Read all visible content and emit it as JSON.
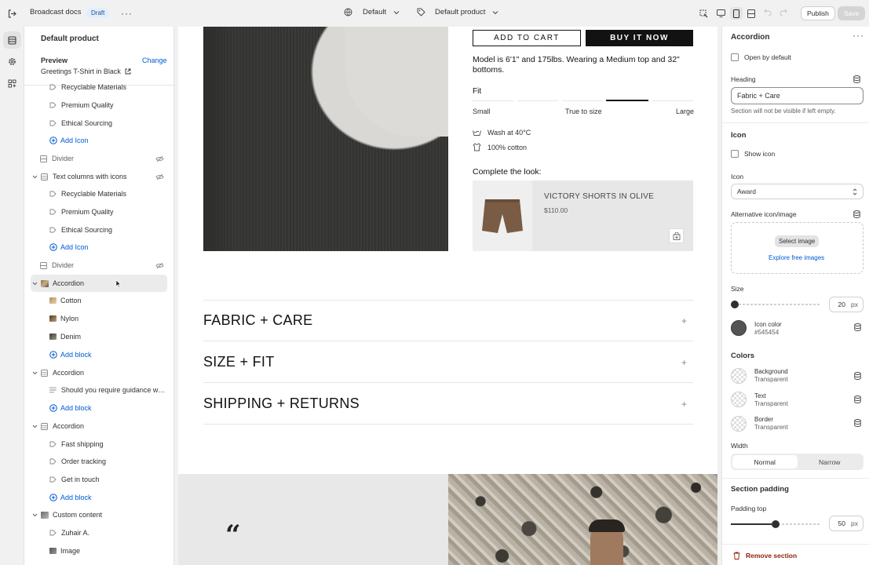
{
  "topbar": {
    "doc_title": "Broadcast docs",
    "status_badge": "Draft",
    "theme_label": "Default",
    "template_label": "Default product",
    "publish_label": "Publish",
    "save_label": "Save"
  },
  "left_panel": {
    "title": "Default product",
    "preview_label": "Preview",
    "change_label": "Change",
    "preview_product": "Greetings T-Shirt in Black",
    "items": [
      {
        "label": "Recyclable Materials"
      },
      {
        "label": "Premium Quality"
      },
      {
        "label": "Ethical Sourcing"
      },
      {
        "label": "Add Icon"
      },
      {
        "label": "Divider"
      },
      {
        "label": "Text columns with icons"
      },
      {
        "label": "Recyclable Materials"
      },
      {
        "label": "Premium Quality"
      },
      {
        "label": "Ethical Sourcing"
      },
      {
        "label": "Add Icon"
      },
      {
        "label": "Divider"
      },
      {
        "label": "Accordion"
      },
      {
        "label": "Cotton"
      },
      {
        "label": "Nylon"
      },
      {
        "label": "Denim"
      },
      {
        "label": "Add block"
      },
      {
        "label": "Accordion"
      },
      {
        "label": "Should you require guidance whi..."
      },
      {
        "label": "Add block"
      },
      {
        "label": "Accordion"
      },
      {
        "label": "Fast shipping"
      },
      {
        "label": "Order tracking"
      },
      {
        "label": "Get in touch"
      },
      {
        "label": "Add block"
      },
      {
        "label": "Custom content"
      },
      {
        "label": "Zuhair A."
      },
      {
        "label": "Image"
      }
    ]
  },
  "canvas": {
    "add_to_cart": "ADD TO CART",
    "buy_it_now": "BUY IT NOW",
    "model_text": "Model is 6'1\" and 175lbs. Wearing a Medium top and 32\" bottoms.",
    "fit_label": "Fit",
    "fit_small": "Small",
    "fit_true": "True to size",
    "fit_large": "Large",
    "fit_level": 0.75,
    "care_wash": "Wash at 40°C",
    "care_cotton": "100% cotton",
    "complete_look": "Complete the look:",
    "rec_product_name": "VICTORY SHORTS IN OLIVE",
    "rec_product_price": "$110.00",
    "accordion_headings": [
      "FABRIC + CARE",
      "SIZE + FIT",
      "SHIPPING + RETURNS"
    ],
    "quote_mark": "“"
  },
  "right_panel": {
    "title": "Accordion",
    "open_by_default": "Open by default",
    "heading_label": "Heading",
    "heading_value": "Fabric + Care",
    "heading_help": "Section will not be visible if left empty.",
    "icon_section": "Icon",
    "show_icon": "Show icon",
    "icon_field_label": "Icon",
    "icon_select_value": "Award",
    "alt_icon_label": "Alternative icon/image",
    "select_image": "Select image",
    "explore_images": "Explore free images",
    "size_label": "Size",
    "size_value": "20",
    "size_unit": "px",
    "size_level": 0.0,
    "icon_color_label": "Icon color",
    "icon_color_value": "#545454",
    "colors_section": "Colors",
    "background_label": "Background",
    "background_value": "Transparent",
    "text_label": "Text",
    "text_value": "Transparent",
    "border_label": "Border",
    "border_value": "Transparent",
    "width_label": "Width",
    "width_normal": "Normal",
    "width_narrow": "Narrow",
    "section_padding": "Section padding",
    "padding_top_label": "Padding top",
    "padding_top_value": "50",
    "padding_unit": "px",
    "padding_level": 0.5,
    "remove_section": "Remove section"
  },
  "colors": {
    "accent": "#005bd3",
    "icon_color": "#545454",
    "danger": "#8e1f0b"
  }
}
